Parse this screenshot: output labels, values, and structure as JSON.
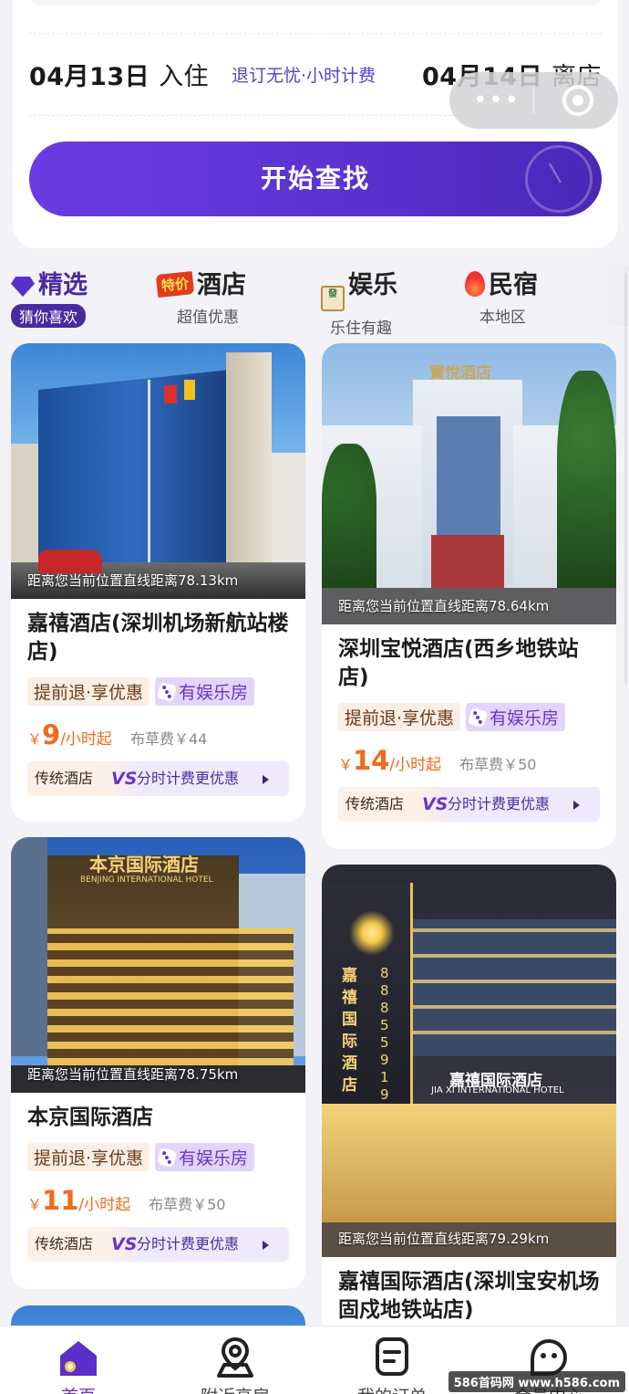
{
  "search": {
    "checkin_date": "04月13日",
    "checkin_label": "入住",
    "policy": "退订无忧·小时计费",
    "checkout_date": "04月14日",
    "checkout_label": "离店",
    "button_label": "开始查找"
  },
  "capsule": {
    "more_icon": "more-dots-icon",
    "close_icon": "target-close-icon"
  },
  "categories": [
    {
      "title": "精选",
      "sub": "猜你喜欢",
      "icon": "diamond-icon",
      "active": true
    },
    {
      "title": "酒店",
      "sub": "超值优惠",
      "icon": "special-price-badge-icon",
      "badge": "特价"
    },
    {
      "title": "娱乐",
      "sub": "乐住有趣",
      "icon": "mahjong-tile-icon",
      "tile": "發"
    },
    {
      "title": "民宿",
      "sub": "本地区",
      "icon": "flame-icon"
    }
  ],
  "hotels": [
    {
      "name": "嘉禧酒店(深圳机场新航站楼店)",
      "distance": "距离您当前位置直线距离78.13km",
      "tag1": "提前退·享优惠",
      "tag2": "有娱乐房",
      "yen": "￥",
      "price": "9",
      "unit": "/小时起",
      "fee": "布草费￥44",
      "banner_left": "传统酒店",
      "banner_vs": "VS",
      "banner_right": "分时计费更优惠"
    },
    {
      "name": "深圳宝悦酒店(西乡地铁站店)",
      "distance": "距离您当前位置直线距离78.64km",
      "tag1": "提前退·享优惠",
      "tag2": "有娱乐房",
      "yen": "￥",
      "price": "14",
      "unit": "/小时起",
      "fee": "布草费￥50",
      "banner_left": "传统酒店",
      "banner_vs": "VS",
      "banner_right": "分时计费更优惠",
      "sign": "寶悅酒店"
    },
    {
      "name": "本京国际酒店",
      "distance": "距离您当前位置直线距离78.75km",
      "tag1": "提前退·享优惠",
      "tag2": "有娱乐房",
      "yen": "￥",
      "price": "11",
      "unit": "/小时起",
      "fee": "布草费￥50",
      "banner_left": "传统酒店",
      "banner_vs": "VS",
      "banner_right": "分时计费更优惠",
      "sign": "本京国际酒店",
      "sign_en": "BENJING INTERNATIONAL HOTEL"
    },
    {
      "name": "嘉禧国际酒店(深圳宝安机场固戍地铁站店)",
      "distance": "距离您当前位置直线距离79.29km",
      "sign": "嘉禧国际酒店",
      "sign_en": "JIA XI INTERNATIONAL HOTEL",
      "sign_vertical": "嘉禧国际酒店",
      "phone_vertical": "88855919"
    }
  ],
  "nav": [
    {
      "label": "首页",
      "icon": "home-icon",
      "active": true
    },
    {
      "label": "附近高房",
      "icon": "map-pin-icon"
    },
    {
      "label": "我的订单",
      "icon": "order-icon"
    },
    {
      "label": "会员中心",
      "icon": "member-face-icon"
    }
  ],
  "watermark": "586首码网 www.h586.com",
  "colors": {
    "accent": "#6a35c8",
    "price": "#f06a1c",
    "button": "#5a31cf"
  }
}
